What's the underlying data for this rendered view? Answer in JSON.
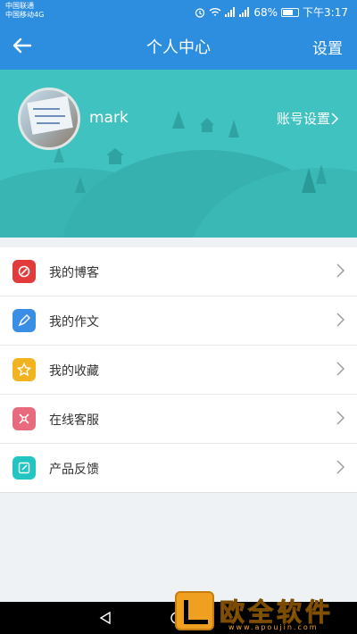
{
  "status_bar": {
    "carrier_1": "中国联通",
    "carrier_2": "中国移动4G",
    "battery": "68%",
    "time": "下午3:17"
  },
  "header": {
    "title": "个人中心",
    "settings_label": "设置"
  },
  "profile": {
    "username": "mark",
    "account_settings_label": "账号设置"
  },
  "menu": [
    {
      "label": "我的博客",
      "icon": "blog-icon",
      "color": "#e23b3b"
    },
    {
      "label": "我的作文",
      "icon": "pencil-icon",
      "color": "#3a8ee6"
    },
    {
      "label": "我的收藏",
      "icon": "star-icon",
      "color": "#f2b320"
    },
    {
      "label": "在线客服",
      "icon": "support-icon",
      "color": "#e86a7e"
    },
    {
      "label": "产品反馈",
      "icon": "feedback-icon",
      "color": "#22c4c4"
    }
  ],
  "watermark": {
    "brand": "欧全软件园",
    "url": "www.apoujin.com"
  }
}
